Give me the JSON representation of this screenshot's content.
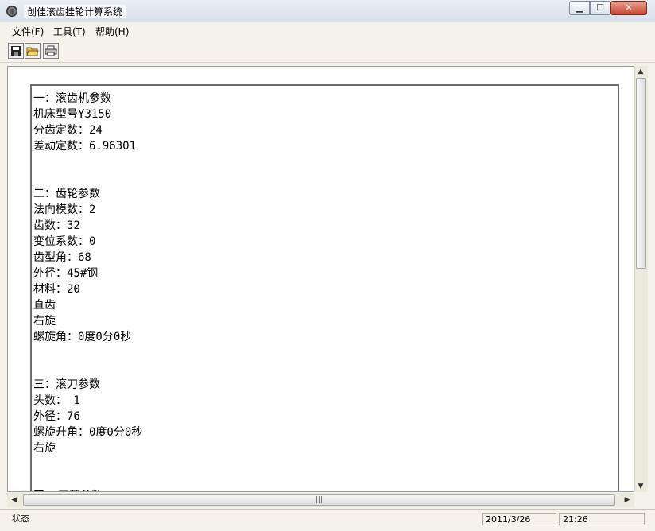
{
  "window": {
    "title": "创佳滚齿挂轮计算系统"
  },
  "window_buttons": {
    "minimize": "▭",
    "maximize": "☐",
    "close": "X"
  },
  "menu": {
    "file": "文件(F)",
    "tools": "工具(T)",
    "help": "帮助(H)"
  },
  "toolbar": {
    "save_icon": "save-icon",
    "open_icon": "open-folder-icon",
    "print_icon": "printer-icon"
  },
  "document": {
    "lines": [
      "一：滚齿机参数",
      "机床型号Y3150",
      "分齿定数：24",
      "差动定数：6.96301",
      "",
      "",
      "二：齿轮参数",
      "法向模数：2",
      "齿数：32",
      "变位系数：0",
      "齿型角：68",
      "外径：45#钢",
      "材料：20",
      "直齿",
      "右旋",
      "螺旋角：0度0分0秒",
      "",
      "",
      "三：滚刀参数",
      "头数： 1",
      "外径：76",
      "螺旋升角：0度0分0秒",
      "右旋",
      "",
      "",
      "四. 工艺参数"
    ]
  },
  "statusbar": {
    "status": "状态",
    "date": "2011/3/26",
    "time": "21:26"
  }
}
